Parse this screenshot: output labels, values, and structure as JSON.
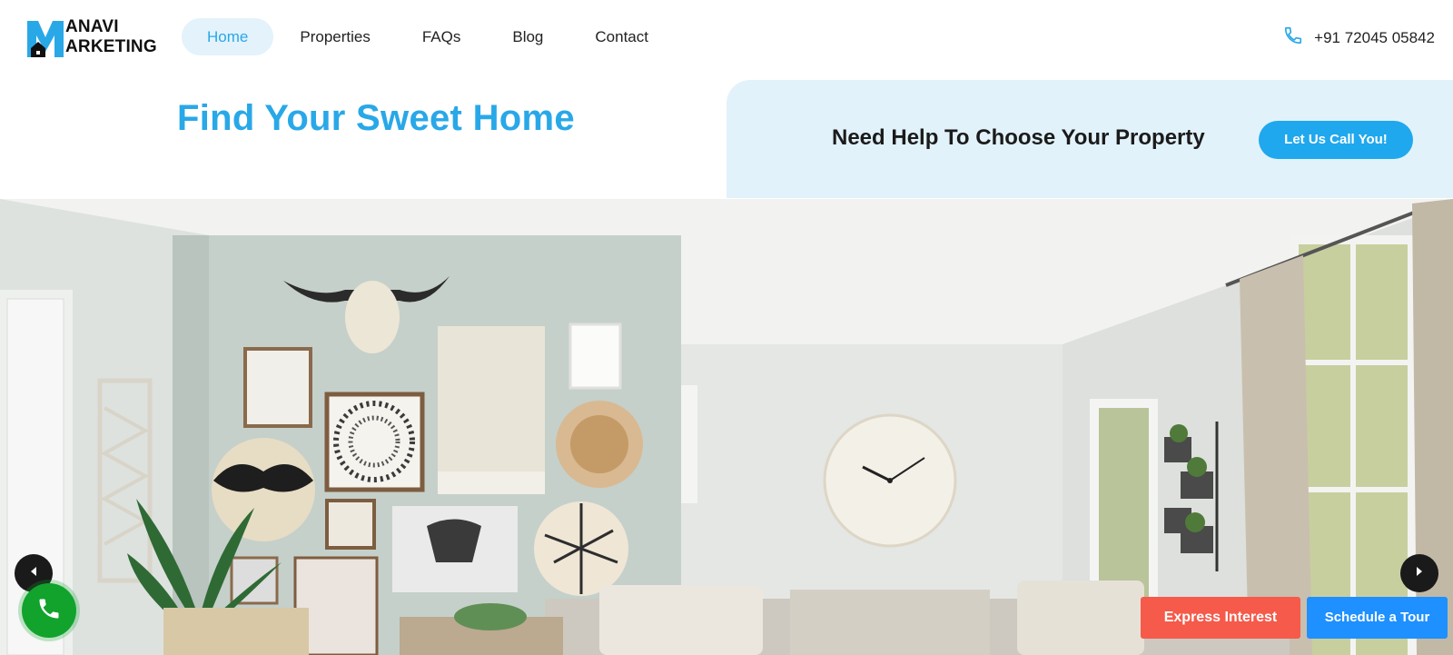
{
  "brand": {
    "line1": "ANAVI",
    "line2": "ARKETING",
    "accent_color": "#29a8e8"
  },
  "nav": {
    "items": [
      {
        "label": "Home",
        "active": true
      },
      {
        "label": "Properties",
        "active": false
      },
      {
        "label": "FAQs",
        "active": false
      },
      {
        "label": "Blog",
        "active": false
      },
      {
        "label": "Contact",
        "active": false
      }
    ]
  },
  "contact": {
    "icon": "phone-icon",
    "phone": "+91 72045 05842"
  },
  "hero": {
    "tagline": "Find Your Sweet Home",
    "help_text": "Need Help To Choose Your Property",
    "call_button": "Let Us Call You!",
    "image_alt": "living-room-photo",
    "prev_icon": "chevron-left-icon",
    "next_icon": "chevron-right-icon"
  },
  "actions": {
    "express_interest": "Express Interest",
    "schedule_tour": "Schedule a Tour",
    "call_fab_icon": "phone-icon",
    "colors": {
      "express": "#f55a4a",
      "tour": "#1e90ff",
      "call_fab": "#11a32c"
    }
  }
}
